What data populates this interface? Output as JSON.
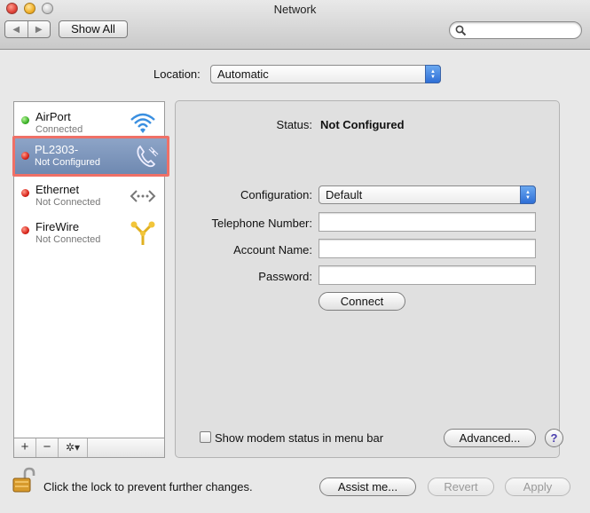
{
  "window": {
    "title": "Network"
  },
  "toolbar": {
    "back_icon": "◀",
    "forward_icon": "▶",
    "show_all_label": "Show All",
    "search_placeholder": ""
  },
  "location": {
    "label": "Location:",
    "value": "Automatic"
  },
  "services": [
    {
      "name": "AirPort",
      "status": "Connected",
      "state": "green",
      "icon": "wifi-icon"
    },
    {
      "name": "PL2303-",
      "status": "Not Configured",
      "state": "red",
      "icon": "modem-phone-icon",
      "selected": true
    },
    {
      "name": "Ethernet",
      "status": "Not Connected",
      "state": "red",
      "icon": "ethernet-icon"
    },
    {
      "name": "FireWire",
      "status": "Not Connected",
      "state": "red",
      "icon": "firewire-icon"
    }
  ],
  "list_footer": {
    "add": "+",
    "remove": "−",
    "gear": "✲▾"
  },
  "detail": {
    "status_label": "Status:",
    "status_value": "Not Configured",
    "configuration_label": "Configuration:",
    "configuration_value": "Default",
    "telephone_label": "Telephone Number:",
    "telephone_value": "",
    "account_label": "Account Name:",
    "account_value": "",
    "password_label": "Password:",
    "password_value": "",
    "connect_label": "Connect",
    "show_modem_status_label": "Show modem status in menu bar",
    "advanced_label": "Advanced...",
    "help_label": "?"
  },
  "footer": {
    "lock_text": "Click the lock to prevent further changes.",
    "assist_label": "Assist me...",
    "revert_label": "Revert",
    "apply_label": "Apply"
  },
  "colors": {
    "selection": "#7a93bb",
    "highlight_border": "#ef7067",
    "popup_accent": "#3f7fe0"
  }
}
